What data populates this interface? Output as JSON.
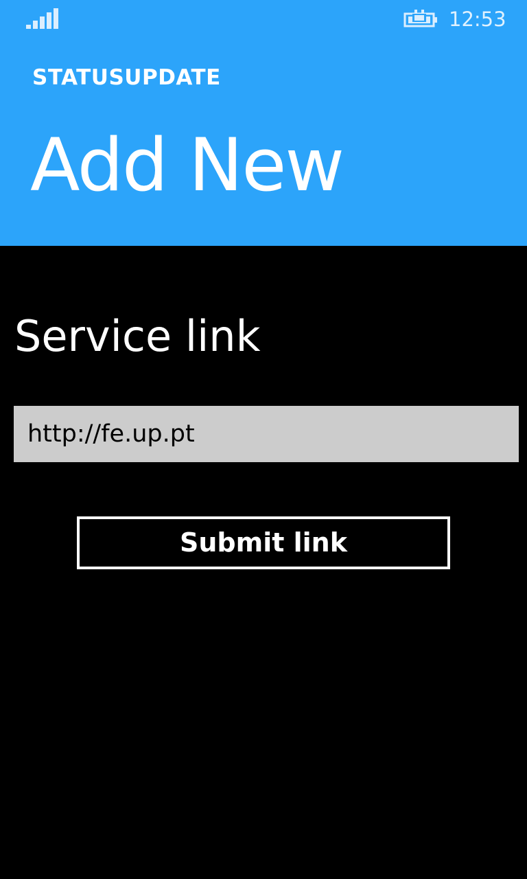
{
  "status_bar": {
    "signal_icon": "signal-strength-icon",
    "battery_icon": "battery-charging-icon",
    "time": "12:53"
  },
  "header": {
    "app_name": "STATUSUPDATE",
    "page_title": "Add New"
  },
  "form": {
    "field_label": "Service link",
    "link_value": "http://fe.up.pt",
    "submit_label": "Submit link"
  },
  "colors": {
    "accent": "#2ca4fa",
    "background": "#000000",
    "input_background": "#cccccc",
    "text": "#ffffff"
  }
}
